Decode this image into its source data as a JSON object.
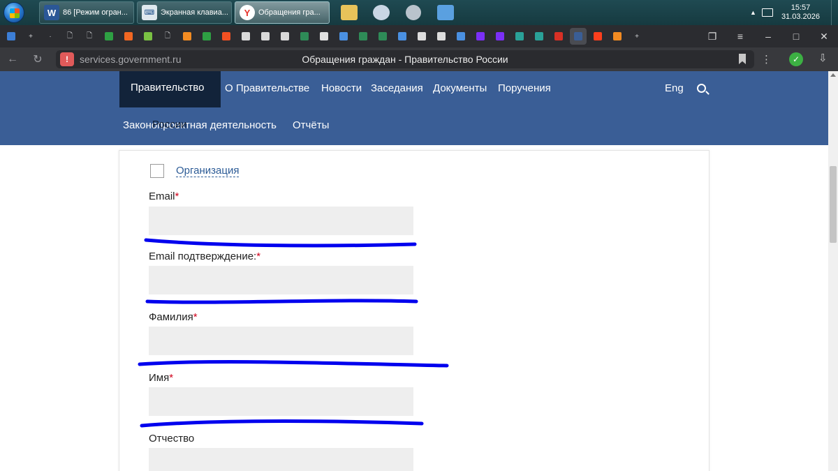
{
  "taskbar": {
    "tasks": [
      {
        "label": "86 [Режим огран...",
        "icon": "word-icon",
        "glyph": "W"
      },
      {
        "label": "Экранная клавиа...",
        "icon": "keyboard-icon",
        "glyph": "⌨"
      },
      {
        "label": "Обращения гра...",
        "icon": "yandex-browser-icon",
        "glyph": "Y"
      }
    ],
    "pinned": [
      {
        "icon": "file-explorer-icon",
        "color": "#e8c35a"
      },
      {
        "icon": "paint-icon",
        "color": "#c9d6e4"
      },
      {
        "icon": "settings-gears-icon",
        "color": "#b9c3cc"
      },
      {
        "icon": "control-panel-icon",
        "color": "#5aa0e0"
      }
    ],
    "clock_time": "15:57",
    "clock_date": "31.03.2026"
  },
  "tabbar": {
    "items": [
      {
        "icon": "blue-square-icon",
        "color": "#3c7ed6"
      },
      {
        "icon": "plus-icon",
        "glyph": "+"
      },
      {
        "icon": "dot-icon",
        "glyph": "·"
      },
      {
        "icon": "document-icon",
        "glyph": "🗋"
      },
      {
        "icon": "document-icon",
        "glyph": "🗋"
      },
      {
        "icon": "green-square-icon",
        "color": "#2ea043"
      },
      {
        "icon": "orange-square-icon",
        "color": "#f26722"
      },
      {
        "icon": "green-badge-icon",
        "color": "#7ac143"
      },
      {
        "icon": "document-icon",
        "glyph": "🗋"
      },
      {
        "icon": "orange-search-icon",
        "color": "#f28b22"
      },
      {
        "icon": "green-square-icon",
        "color": "#2ea043"
      },
      {
        "icon": "orange-square-icon",
        "color": "#f25022"
      },
      {
        "icon": "scales-icon",
        "color": "#d9d9d9"
      },
      {
        "icon": "scales-icon",
        "color": "#d9d9d9"
      },
      {
        "icon": "scales-icon",
        "color": "#d9d9d9"
      },
      {
        "icon": "gs1-icon",
        "color": "#2e8b57"
      },
      {
        "icon": "barcode-icon",
        "color": "#e0e0e0"
      },
      {
        "icon": "signal-icon",
        "color": "#4a90e2"
      },
      {
        "icon": "gs1-icon",
        "color": "#2e8b57"
      },
      {
        "icon": "gs1-icon",
        "color": "#2e8b57"
      },
      {
        "icon": "signal-icon",
        "color": "#4a90e2"
      },
      {
        "icon": "target-icon",
        "color": "#dddddd"
      },
      {
        "icon": "target-icon",
        "color": "#dddddd"
      },
      {
        "icon": "signal-icon",
        "color": "#4a90e2"
      },
      {
        "icon": "purple-ring-icon",
        "color": "#7b2ff7"
      },
      {
        "icon": "purple-ring-icon",
        "color": "#7b2ff7"
      },
      {
        "icon": "question-icon",
        "color": "#2aa198"
      },
      {
        "icon": "question-icon",
        "color": "#2aa198"
      },
      {
        "icon": "pdf-icon",
        "color": "#d93025"
      },
      {
        "icon": "government-site-icon",
        "color": "#3a5e96",
        "active": true
      },
      {
        "icon": "yandex-icon",
        "color": "#fc3f1d"
      },
      {
        "icon": "orange-search-icon",
        "color": "#f28b22"
      },
      {
        "icon": "new-tab-icon",
        "glyph": "+"
      }
    ]
  },
  "address_bar": {
    "url": "services.government.ru",
    "page_title": "Обращения граждан - Правительство России"
  },
  "site": {
    "logo_line1": "Правительство",
    "logo_line2": "России",
    "nav_row1": [
      "О Правительстве",
      "Новости",
      "Заседания",
      "Документы",
      "Поручения"
    ],
    "nav_row2": [
      "Законопроектная деятельность",
      "Отчёты"
    ],
    "lang": "Eng"
  },
  "form": {
    "org_checkbox_label": "Организация",
    "fields": [
      {
        "label": "Email",
        "required": "*",
        "value": ""
      },
      {
        "label": "Email подтверждение:",
        "required": "*",
        "value": ""
      },
      {
        "label": "Фамилия",
        "required": "*",
        "value": ""
      },
      {
        "label": "Имя",
        "required": "*",
        "value": ""
      },
      {
        "label": "Отчество",
        "required": "",
        "value": ""
      }
    ]
  },
  "colors": {
    "header_bg": "#3a5e96",
    "logo_bg": "#12233a",
    "link": "#2c5b96",
    "required": "#d0021b",
    "ink": "#0000ee"
  }
}
